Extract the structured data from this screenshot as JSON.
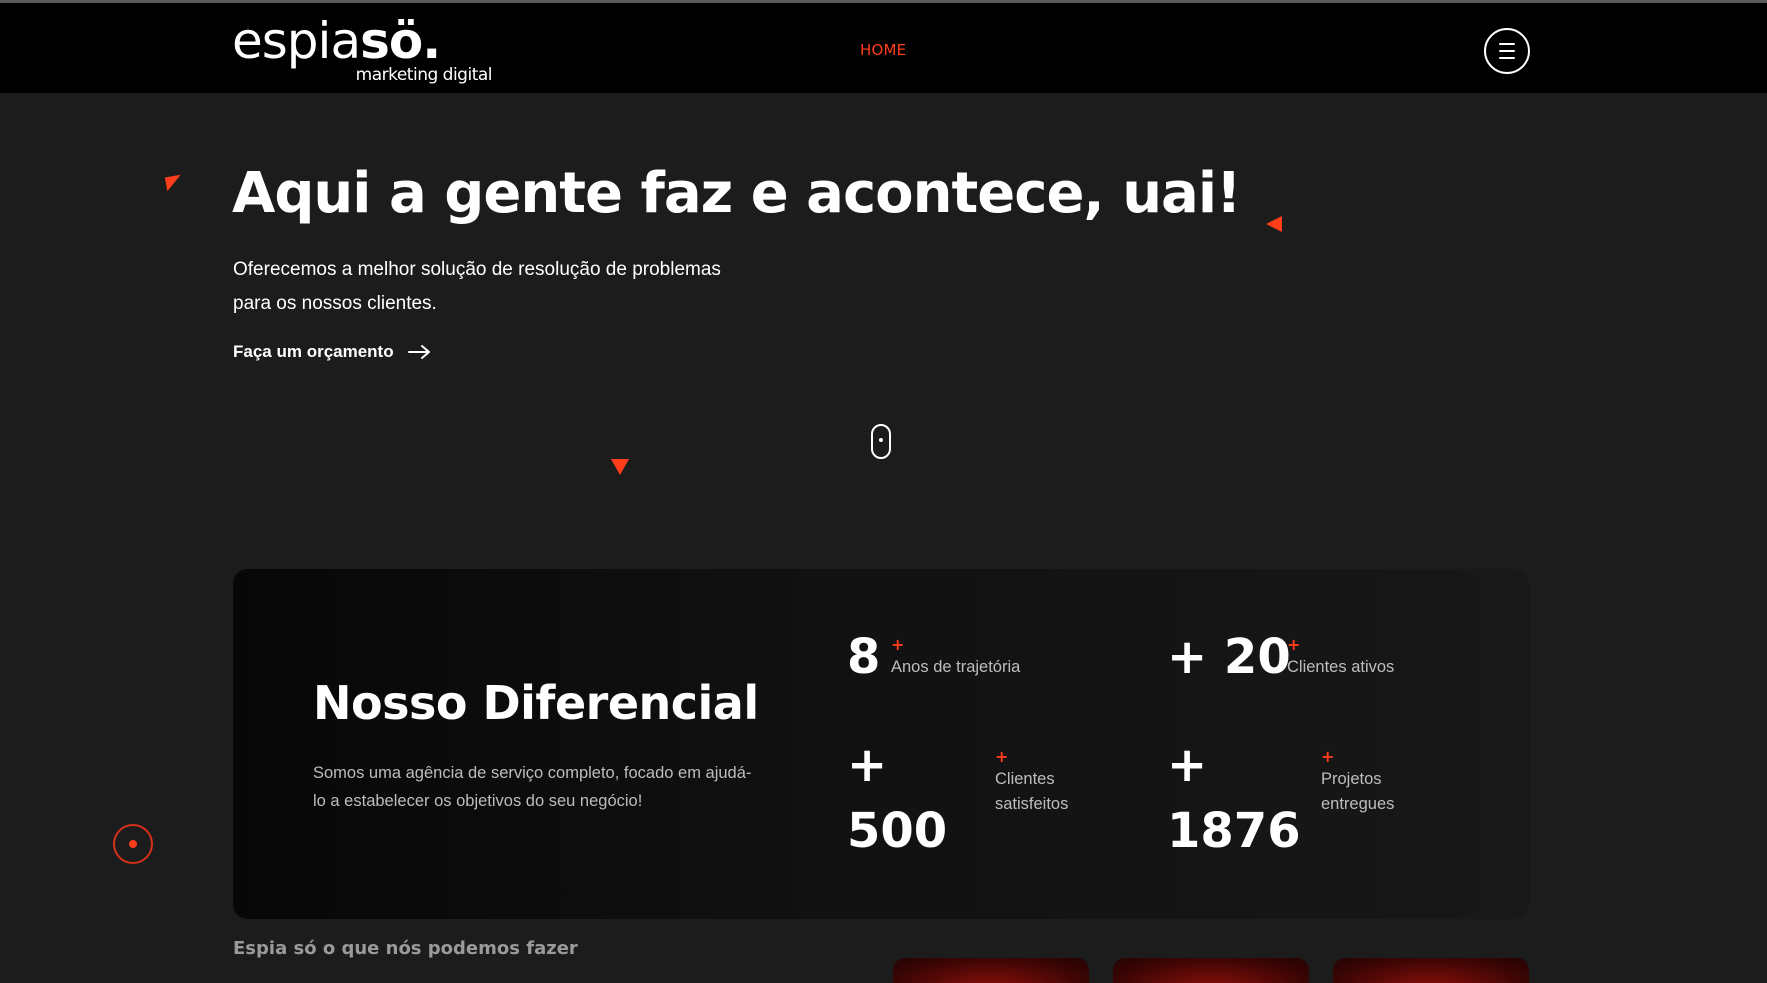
{
  "header": {
    "logo": {
      "main_thin": "espia",
      "main_bold": "sö.",
      "sub": "marketing digital"
    },
    "nav": {
      "home": "HOME"
    },
    "menu_icon": "hamburger-menu-icon"
  },
  "hero": {
    "title": "Aqui a gente faz e acontece, uai!",
    "subtitle": "Oferecemos a melhor solução de resolução de problemas para os nossos clientes.",
    "cta_label": "Faça um orçamento",
    "cta_icon": "arrow-right-icon",
    "scroll_icon": "mouse-scroll-icon"
  },
  "differential": {
    "title": "Nosso Diferencial",
    "description": "Somos uma agência de serviço completo, focado em ajudá-lo a estabelecer os objetivos do seu negócio!",
    "stats": [
      {
        "value": "8",
        "plus": "+",
        "label": "Anos de trajetória"
      },
      {
        "value": "+ 20",
        "plus": "+",
        "label": "Clientes ativos"
      },
      {
        "value_prefix": "+",
        "value": "500",
        "plus": "+",
        "label": "Clientes satisfeitos"
      },
      {
        "value_prefix": "+",
        "value": "1876",
        "plus": "+",
        "label": "Projetos entregues"
      }
    ]
  },
  "services": {
    "subtitle": "Espia só o que nós podemos fazer"
  },
  "colors": {
    "accent": "#ff3d1a",
    "background": "#1c1c1c",
    "header_bg": "#000000"
  }
}
